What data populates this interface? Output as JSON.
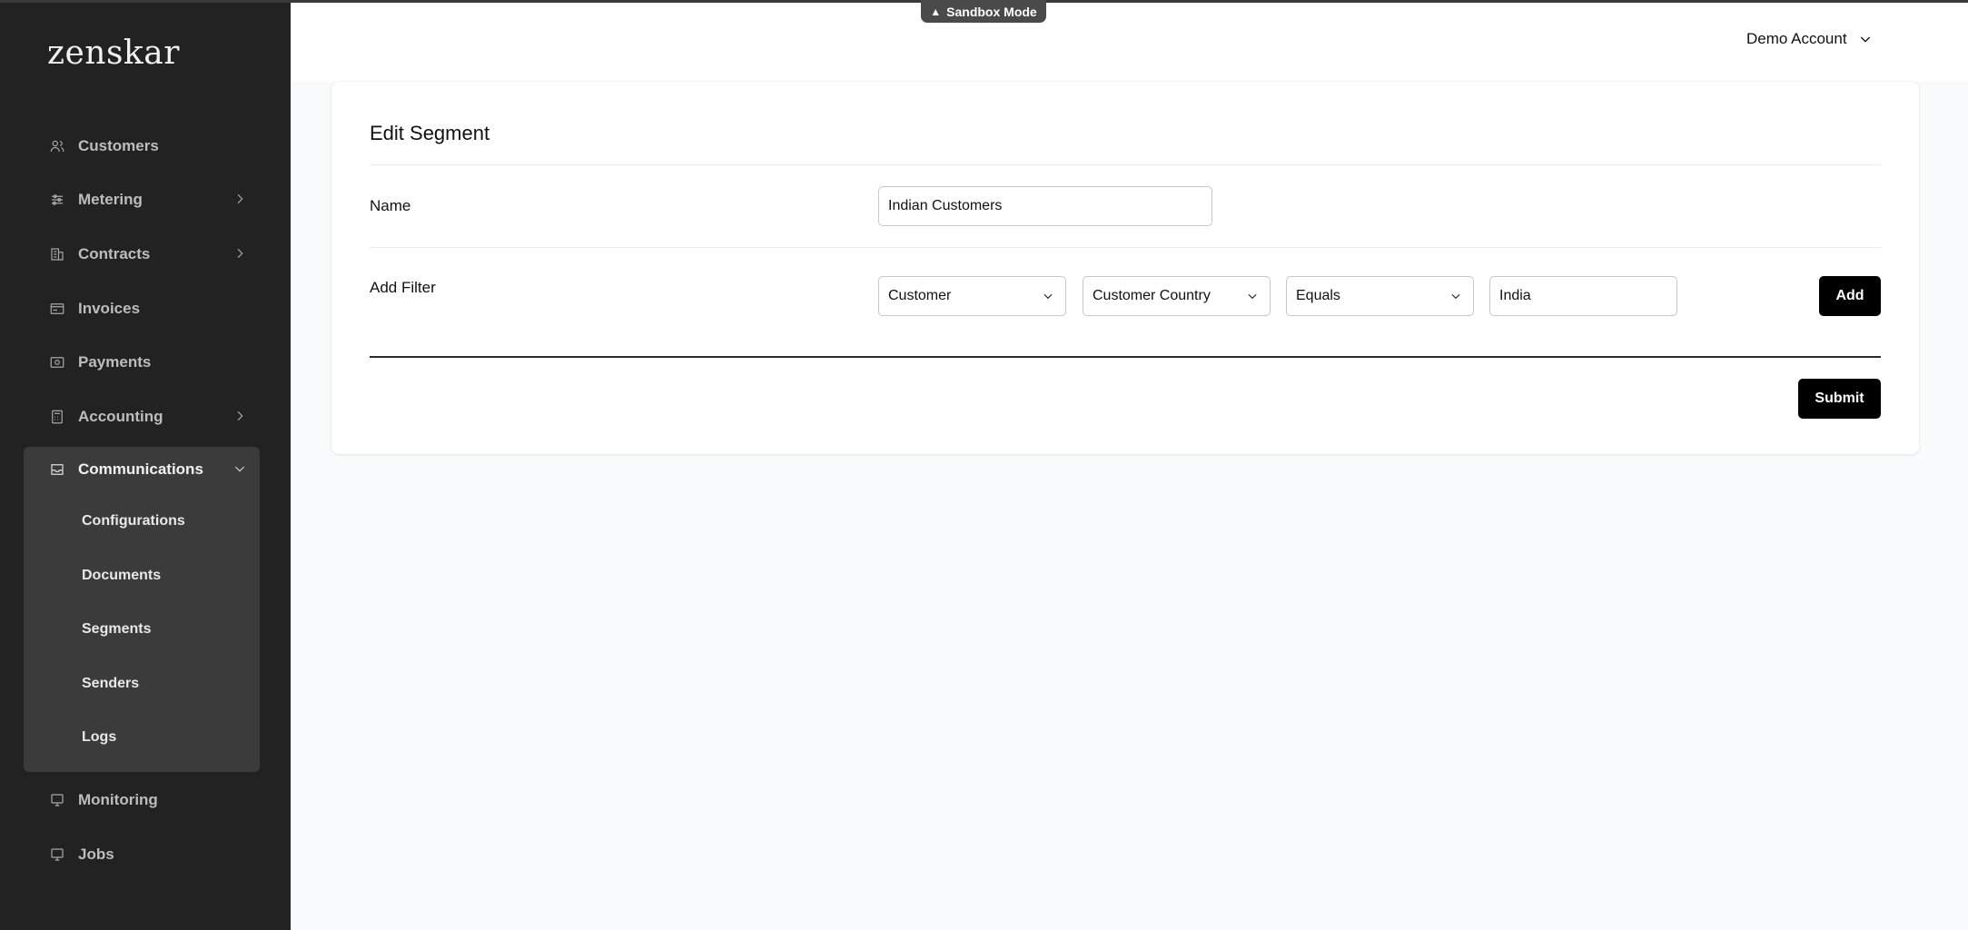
{
  "app": {
    "logo": "zenskar"
  },
  "banner": {
    "sandbox_label": "Sandbox Mode"
  },
  "header": {
    "account_label": "Demo Account"
  },
  "sidebar": {
    "items": [
      {
        "label": "Customers",
        "icon": "users-icon"
      },
      {
        "label": "Metering",
        "icon": "sliders-icon",
        "expandable": true
      },
      {
        "label": "Contracts",
        "icon": "building-icon",
        "expandable": true
      },
      {
        "label": "Invoices",
        "icon": "card-icon"
      },
      {
        "label": "Payments",
        "icon": "cash-icon"
      },
      {
        "label": "Accounting",
        "icon": "calculator-icon",
        "expandable": true
      },
      {
        "label": "Communications",
        "icon": "inbox-icon",
        "expanded": true
      },
      {
        "label": "Monitoring",
        "icon": "monitor-icon"
      },
      {
        "label": "Jobs",
        "icon": "monitor-icon"
      }
    ],
    "communications_sub": [
      "Configurations",
      "Documents",
      "Segments",
      "Senders",
      "Logs"
    ]
  },
  "form": {
    "title": "Edit Segment",
    "name_label": "Name",
    "name_value": "Indian Customers",
    "filter_label": "Add Filter",
    "filter_entity": "Customer",
    "filter_field": "Customer Country",
    "filter_operator": "Equals",
    "filter_value": "India",
    "add_button": "Add",
    "submit_button": "Submit"
  }
}
